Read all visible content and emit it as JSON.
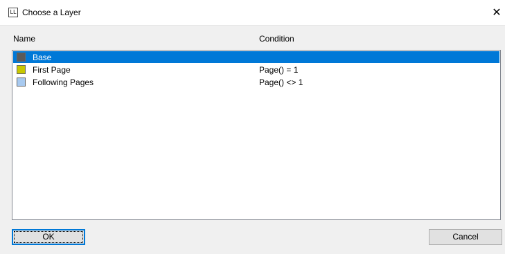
{
  "window": {
    "title": "Choose a Layer",
    "app_icon_text": "LL",
    "close_symbol": "✕"
  },
  "columns": {
    "name": "Name",
    "condition": "Condition"
  },
  "layers": [
    {
      "name": "Base",
      "condition": "",
      "color": "#5a5a5a",
      "selected": true
    },
    {
      "name": "First Page",
      "condition": "Page() = 1",
      "color": "#c8c800",
      "selected": false
    },
    {
      "name": "Following Pages",
      "condition": "Page() <> 1",
      "color": "#a8caf0",
      "selected": false
    }
  ],
  "buttons": {
    "ok": "OK",
    "cancel": "Cancel"
  },
  "colors": {
    "selection": "#0078d7",
    "focus_border": "#0078d7"
  }
}
